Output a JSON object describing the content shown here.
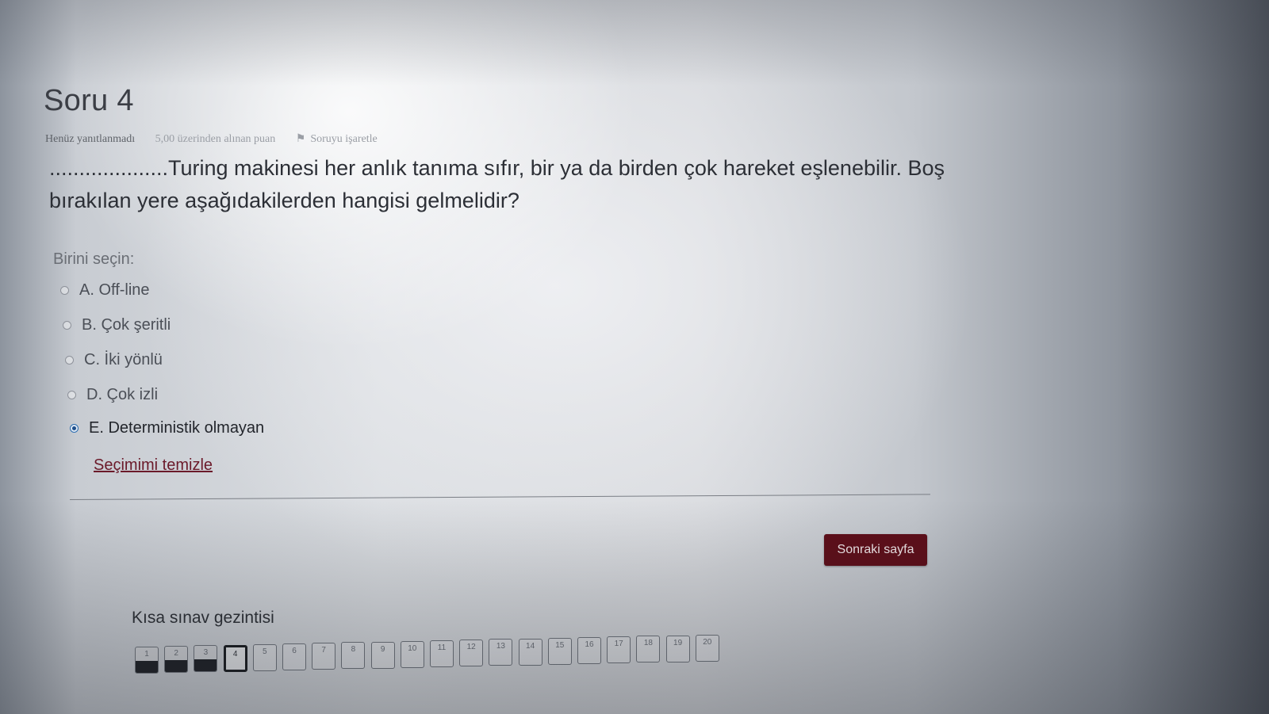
{
  "question": {
    "title": "Soru 4",
    "status": "Henüz yanıtlanmadı",
    "points": "5,00 üzerinden alınan puan",
    "flag_label": "Soruyu işaretle",
    "text": "....................Turing makinesi her anlık tanıma sıfır, bir ya da birden çok hareket eşlenebilir. Boş bırakılan yere aşağıdakilerden hangisi gelmelidir?"
  },
  "answer": {
    "prompt": "Birini seçin:",
    "options": [
      {
        "label": "A. Off-line",
        "selected": false
      },
      {
        "label": "B. Çok şeritli",
        "selected": false
      },
      {
        "label": "C. İki yönlü",
        "selected": false
      },
      {
        "label": "D. Çok izli",
        "selected": false
      },
      {
        "label": "E. Deterministik olmayan",
        "selected": true
      }
    ],
    "clear_label": "Seçimimi temizle"
  },
  "next_button": {
    "label": "Sonraki sayfa",
    "color": "#5e0d18"
  },
  "quiz_nav": {
    "title": "Kısa sınav gezintisi",
    "current": 4,
    "buttons": [
      {
        "num": "1",
        "answered": true
      },
      {
        "num": "2",
        "answered": true
      },
      {
        "num": "3",
        "answered": true
      },
      {
        "num": "4",
        "answered": false
      },
      {
        "num": "5",
        "answered": false
      },
      {
        "num": "6",
        "answered": false
      },
      {
        "num": "7",
        "answered": false
      },
      {
        "num": "8",
        "answered": false
      },
      {
        "num": "9",
        "answered": false
      },
      {
        "num": "10",
        "answered": false
      },
      {
        "num": "11",
        "answered": false
      },
      {
        "num": "12",
        "answered": false
      },
      {
        "num": "13",
        "answered": false
      },
      {
        "num": "14",
        "answered": false
      },
      {
        "num": "15",
        "answered": false
      },
      {
        "num": "16",
        "answered": false
      },
      {
        "num": "17",
        "answered": false
      },
      {
        "num": "18",
        "answered": false
      },
      {
        "num": "19",
        "answered": false
      },
      {
        "num": "20",
        "answered": false
      }
    ]
  }
}
